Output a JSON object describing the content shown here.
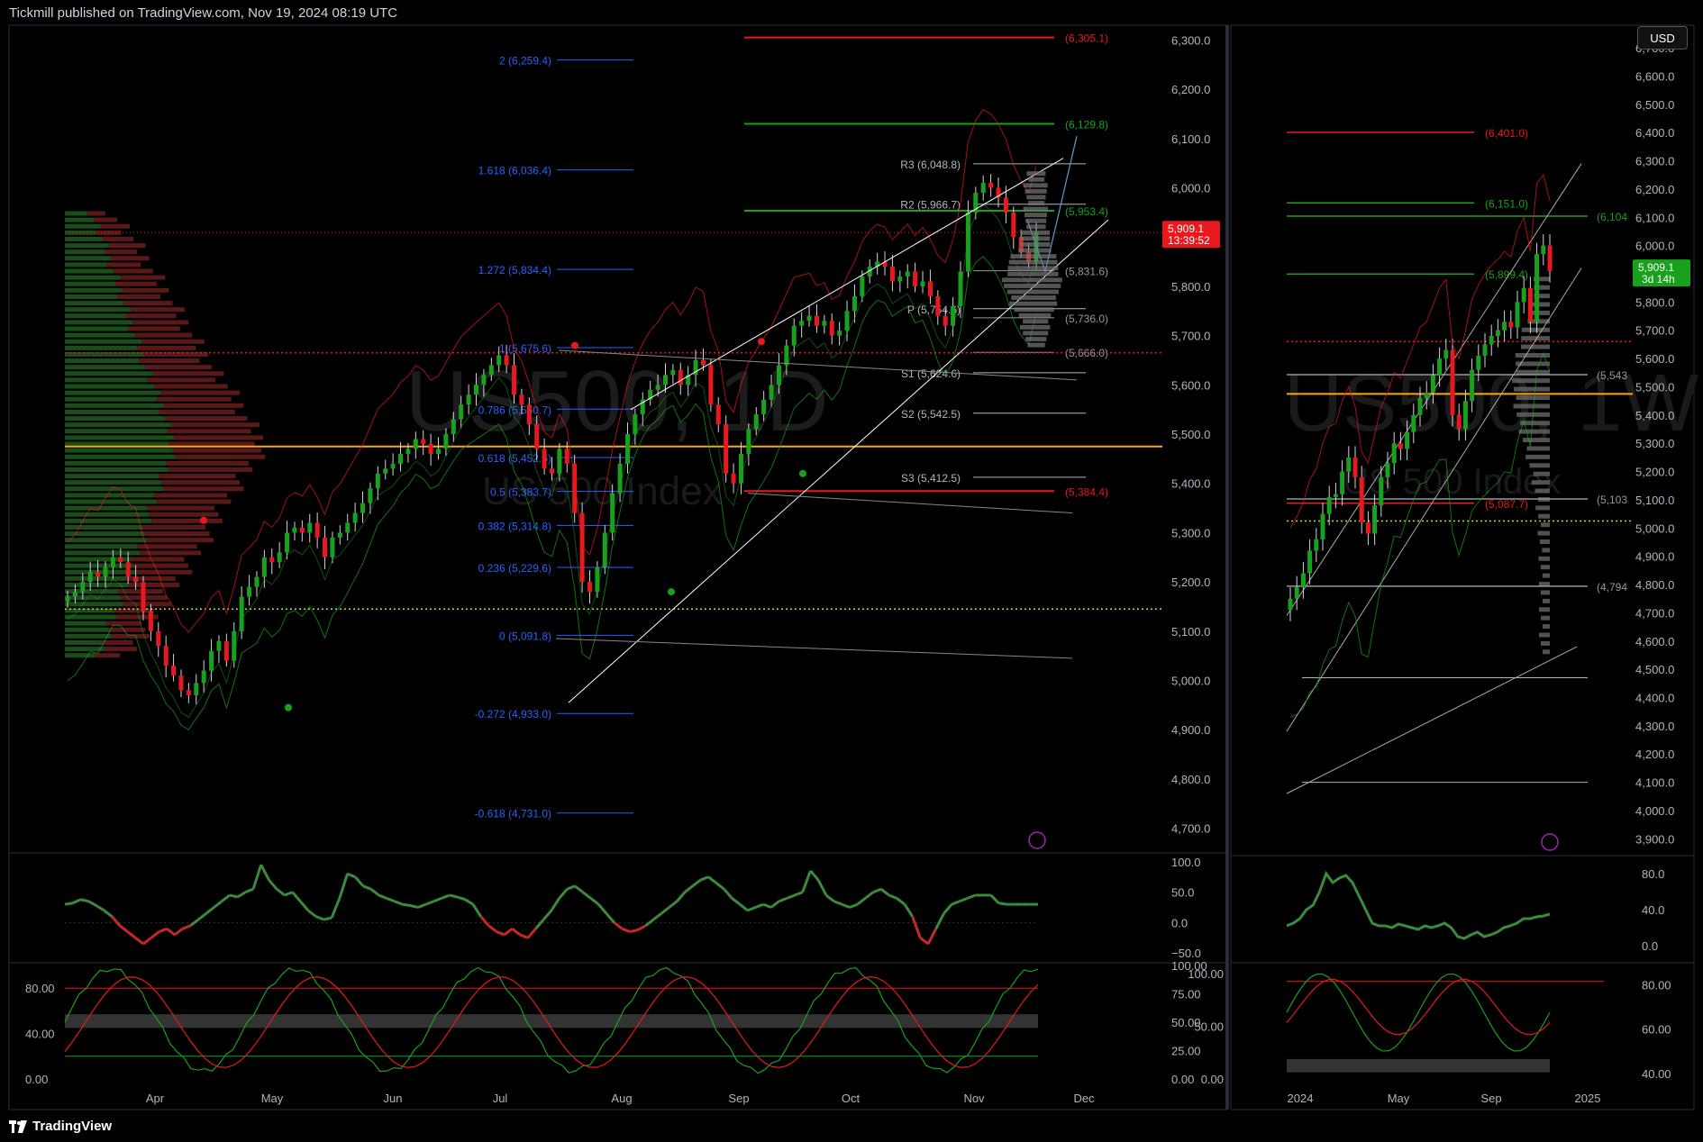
{
  "header": {
    "text": "Tickmill published on TradingView.com, Nov 19, 2024 08:19 UTC"
  },
  "footer": {
    "brand": "TradingView"
  },
  "usd_button": "USD",
  "colors": {
    "up": "#19a11d",
    "down": "#e8191e",
    "orange": "#f5a623",
    "fib": "#2962ff",
    "pivot": "#b2b5be"
  },
  "chart_data": [
    {
      "type": "line",
      "symbol": "US500",
      "timeframe": "1D",
      "description": "US 500 Index",
      "price_axis": [
        "6,300.0",
        "6,200.0",
        "6,100.0",
        "6,000.0",
        "5,900.0",
        "5,800.0",
        "5,700.0",
        "5,600.0",
        "5,500.0",
        "5,400.0",
        "5,300.0",
        "5,200.0",
        "5,100.0",
        "5,000.0",
        "4,900.0",
        "4,800.0",
        "4,700.0"
      ],
      "ylim": [
        4650,
        6330
      ],
      "time_axis": [
        "Apr",
        "May",
        "Jun",
        "Jul",
        "Aug",
        "Sep",
        "Oct",
        "Nov",
        "Dec"
      ],
      "last_price": {
        "label": "5,909.1",
        "countdown": "13:39:52",
        "value": 5909.1
      },
      "fib_levels": [
        {
          "label": "2 (6,259.4)",
          "value": 6259.4
        },
        {
          "label": "1.618 (6,036.4)",
          "value": 6036.4
        },
        {
          "label": "1.272 (5,834.4)",
          "value": 5834.4
        },
        {
          "label": "1 (5,675.6)",
          "value": 5675.6
        },
        {
          "label": "0.786 (5,550.7)",
          "value": 5550.7
        },
        {
          "label": "0.618 (5,452.6)",
          "value": 5452.6
        },
        {
          "label": "0.5 (5,383.7)",
          "value": 5383.7
        },
        {
          "label": "0.382 (5,314.8)",
          "value": 5314.8
        },
        {
          "label": "0.236 (5,229.6)",
          "value": 5229.6
        },
        {
          "label": "0 (5,091.8)",
          "value": 5091.8
        },
        {
          "label": "-0.272 (4,933.0)",
          "value": 4933.0
        },
        {
          "label": "-0.618 (4,731.0)",
          "value": 4731.0
        }
      ],
      "pivots": [
        {
          "label": "R3 (6,048.8)",
          "value": 6048.8
        },
        {
          "label": "R2 (5,966.7)",
          "value": 5966.7
        },
        {
          "label": "P (5,754.6)",
          "value": 5754.6
        },
        {
          "label": "S1 (5,624.6)",
          "value": 5624.6
        },
        {
          "label": "S2 (5,542.5)",
          "value": 5542.5
        },
        {
          "label": "S3 (5,412.5)",
          "value": 5412.5
        }
      ],
      "levels": [
        {
          "label": "(6,305.1)",
          "value": 6305.1,
          "color": "red"
        },
        {
          "label": "(6,129.8)",
          "value": 6129.8,
          "color": "green"
        },
        {
          "label": "(5,953.4)",
          "value": 5953.4,
          "color": "green"
        },
        {
          "label": "(5,831.6)",
          "value": 5831.6,
          "color": "grey"
        },
        {
          "label": "(5,736.0)",
          "value": 5736.0,
          "color": "grey"
        },
        {
          "label": "(5,666.0)",
          "value": 5666.0,
          "color": "grey"
        },
        {
          "label": "(5,384.4)",
          "value": 5384.4,
          "color": "red"
        }
      ],
      "orange_level": 5475,
      "dotted_levels": [
        5665,
        5145
      ],
      "close": [
        5170,
        5180,
        5200,
        5220,
        5210,
        5230,
        5250,
        5240,
        5210,
        5200,
        5140,
        5100,
        5070,
        5030,
        5010,
        4980,
        4970,
        4995,
        5020,
        5060,
        5080,
        5040,
        5100,
        5170,
        5190,
        5210,
        5250,
        5240,
        5260,
        5300,
        5310,
        5300,
        5320,
        5290,
        5250,
        5290,
        5300,
        5320,
        5340,
        5360,
        5390,
        5420,
        5430,
        5440,
        5460,
        5470,
        5490,
        5480,
        5460,
        5470,
        5500,
        5530,
        5560,
        5580,
        5600,
        5620,
        5640,
        5660,
        5640,
        5580,
        5560,
        5520,
        5470,
        5430,
        5420,
        5470,
        5440,
        5340,
        5200,
        5180,
        5230,
        5300,
        5380,
        5440,
        5500,
        5540,
        5570,
        5590,
        5600,
        5620,
        5630,
        5600,
        5620,
        5650,
        5640,
        5560,
        5520,
        5420,
        5400,
        5460,
        5510,
        5540,
        5570,
        5600,
        5640,
        5680,
        5720,
        5730,
        5740,
        5720,
        5730,
        5700,
        5710,
        5750,
        5780,
        5820,
        5840,
        5850,
        5840,
        5810,
        5820,
        5830,
        5800,
        5810,
        5780,
        5740,
        5720,
        5760,
        5830,
        5950,
        5990,
        6010,
        6000,
        5980,
        5950,
        5900,
        5870,
        5850,
        5909
      ]
    },
    {
      "type": "line",
      "symbol": "US500",
      "timeframe": "1W",
      "description": "US 500 Index",
      "price_axis": [
        "6,700.0",
        "6,600.0",
        "6,500.0",
        "6,400.0",
        "6,300.0",
        "6,200.0",
        "6,100.0",
        "6,000.0",
        "5,900.0",
        "5,800.0",
        "5,700.0",
        "5,600.0",
        "5,500.0",
        "5,400.0",
        "5,300.0",
        "5,200.0",
        "5,100.0",
        "5,000.0",
        "4,900.0",
        "4,800.0",
        "4,700.0",
        "4,600.0",
        "4,500.0",
        "4,400.0",
        "4,300.0",
        "4,200.0",
        "4,100.0",
        "4,000.0",
        "3,900.0"
      ],
      "ylim": [
        3850,
        6780
      ],
      "time_axis": [
        "2024",
        "May",
        "Sep",
        "2025"
      ],
      "last_price": {
        "label": "5,909.1",
        "countdown": "3d 14h",
        "value": 5909.1
      },
      "levels": [
        {
          "label": "(6,401.0)",
          "value": 6401.0,
          "color": "red"
        },
        {
          "label": "(6,151.0)",
          "value": 6151.0,
          "color": "green"
        },
        {
          "label": "(6,104",
          "value": 6104,
          "color": "green"
        },
        {
          "label": "(5,899.4)",
          "value": 5899.4,
          "color": "green"
        },
        {
          "label": "(5,543",
          "value": 5543,
          "color": "grey"
        },
        {
          "label": "(5,103",
          "value": 5103,
          "color": "grey"
        },
        {
          "label": "(5,087.7)",
          "value": 5087.7,
          "color": "red"
        },
        {
          "label": "(4,794",
          "value": 4794,
          "color": "grey"
        }
      ],
      "close": [
        4750,
        4790,
        4840,
        4920,
        4960,
        5050,
        5110,
        5120,
        5200,
        5250,
        5180,
        5020,
        4980,
        5080,
        5180,
        5230,
        5300,
        5280,
        5340,
        5400,
        5460,
        5480,
        5540,
        5600,
        5630,
        5400,
        5350,
        5450,
        5560,
        5610,
        5650,
        5680,
        5700,
        5730,
        5710,
        5800,
        5850,
        5730,
        5970,
        6000,
        5909
      ]
    },
    {
      "type": "line",
      "name": "oscillator-1d",
      "ticks": [
        "100.0",
        "50.0",
        "0.0",
        "−50.0"
      ],
      "ylim": [
        -60,
        110
      ],
      "values": [
        30,
        32,
        38,
        35,
        28,
        20,
        10,
        -5,
        -15,
        -25,
        -35,
        -25,
        -15,
        -10,
        -20,
        -10,
        -5,
        5,
        15,
        25,
        35,
        45,
        42,
        50,
        55,
        95,
        70,
        55,
        45,
        50,
        35,
        20,
        10,
        5,
        8,
        40,
        80,
        75,
        60,
        55,
        45,
        40,
        35,
        30,
        28,
        25,
        30,
        35,
        40,
        45,
        42,
        38,
        30,
        10,
        -5,
        -15,
        -20,
        -10,
        -20,
        -25,
        -10,
        5,
        20,
        40,
        55,
        60,
        50,
        40,
        30,
        15,
        0,
        -10,
        -15,
        -12,
        -5,
        5,
        15,
        25,
        35,
        50,
        60,
        70,
        75,
        65,
        55,
        40,
        30,
        20,
        25,
        30,
        25,
        35,
        40,
        45,
        50,
        85,
        70,
        45,
        35,
        30,
        25,
        30,
        40,
        50,
        55,
        45,
        40,
        30,
        10,
        -25,
        -35,
        -10,
        15,
        30,
        35,
        40,
        45,
        45,
        45,
        32,
        30,
        30,
        30,
        30,
        30
      ]
    },
    {
      "type": "line",
      "name": "stochastic-1d",
      "ticks": [
        "100.00",
        "75.00",
        "50.00",
        "25.00",
        "0.00"
      ],
      "left_ticks": [
        "80.00",
        "40.00",
        "0.00"
      ],
      "ylim": [
        0,
        100
      ]
    },
    {
      "type": "line",
      "name": "oscillator-1w",
      "ticks": [
        "80.0",
        "40.0",
        "0.0"
      ],
      "ylim": [
        -10,
        95
      ],
      "values": [
        22,
        25,
        30,
        40,
        45,
        60,
        80,
        70,
        75,
        78,
        70,
        55,
        40,
        25,
        22,
        22,
        20,
        24,
        22,
        20,
        18,
        22,
        20,
        22,
        25,
        20,
        10,
        8,
        12,
        15,
        10,
        12,
        15,
        20,
        22,
        25,
        30,
        30,
        32,
        33,
        35
      ]
    },
    {
      "type": "line",
      "name": "stochastic-1w",
      "ticks": [
        "80.00",
        "60.00",
        "40.00"
      ],
      "left_ticks": [
        "100.00",
        "50.00",
        "0.00"
      ],
      "ylim": [
        0,
        100
      ]
    }
  ]
}
